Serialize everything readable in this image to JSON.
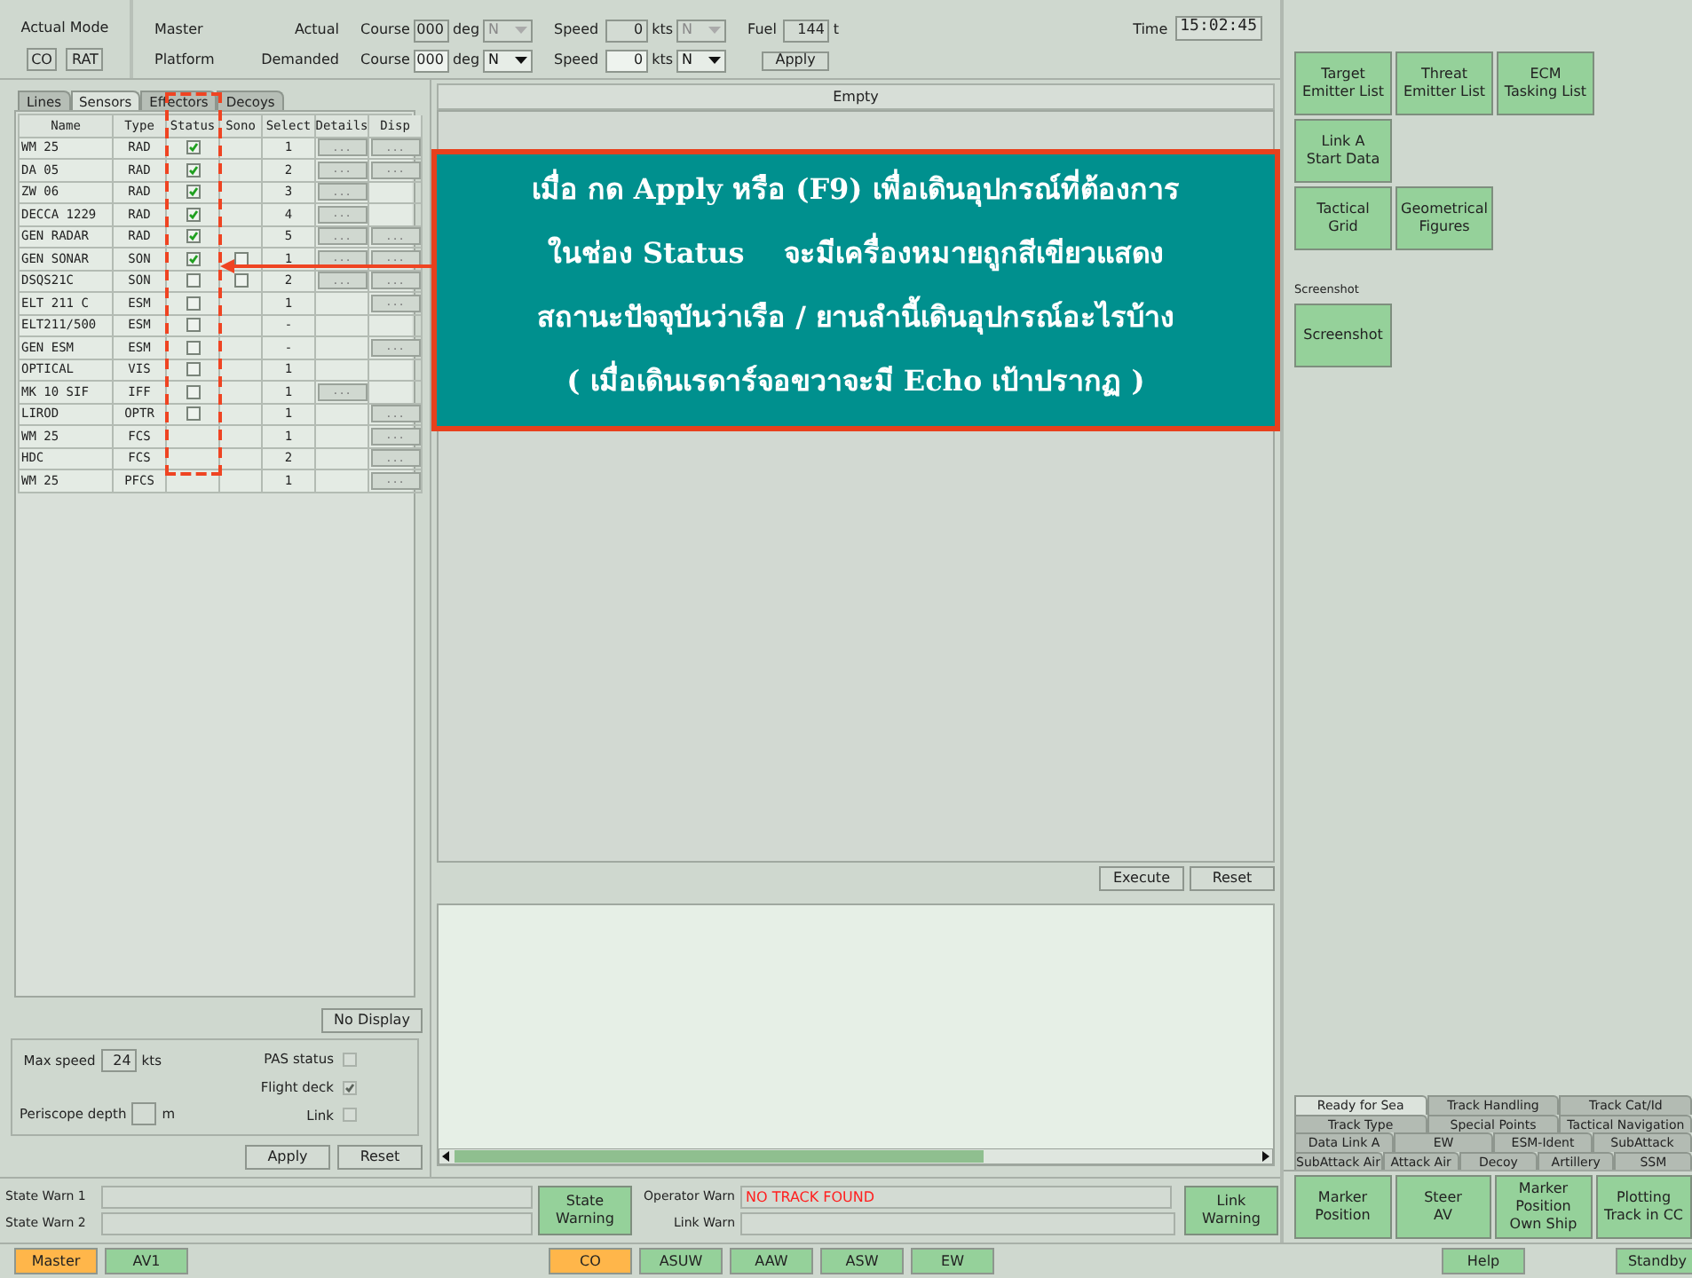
{
  "mode": {
    "label": "Actual Mode",
    "values": [
      "CO",
      "RAT"
    ]
  },
  "nav": {
    "rows": [
      {
        "role": "Master",
        "kind": "Actual",
        "course_label": "Course",
        "course": "000",
        "course_unit": "deg",
        "course_ref": "N",
        "speed_label": "Speed",
        "speed": "0",
        "speed_unit": "kts",
        "speed_ref": "N",
        "disabled": true
      },
      {
        "role": "Platform",
        "kind": "Demanded",
        "course_label": "Course",
        "course": "000",
        "course_unit": "deg",
        "course_ref": "N",
        "speed_label": "Speed",
        "speed": "0",
        "speed_unit": "kts",
        "speed_ref": "N",
        "disabled": false
      }
    ],
    "fuel_label": "Fuel",
    "fuel": "144",
    "fuel_unit": "t",
    "apply": "Apply"
  },
  "time": {
    "label": "Time",
    "value": "15:02:45"
  },
  "left_tabs": [
    {
      "label": "Lines",
      "selected": false
    },
    {
      "label": "Sensors",
      "selected": true
    },
    {
      "label": "Effectors",
      "selected": false
    },
    {
      "label": "Decoys",
      "selected": false
    }
  ],
  "table": {
    "columns": [
      "Name",
      "Type",
      "Status",
      "Sono",
      "Select",
      "Details",
      "Disp"
    ],
    "rows": [
      {
        "name": "WM 25",
        "type": "RAD",
        "status": true,
        "select": "1",
        "details": "...",
        "disp": "..."
      },
      {
        "name": "DA 05",
        "type": "RAD",
        "status": true,
        "select": "2",
        "details": "...",
        "disp": "..."
      },
      {
        "name": "ZW 06",
        "type": "RAD",
        "status": true,
        "select": "3",
        "details": "..."
      },
      {
        "name": "DECCA 1229",
        "type": "RAD",
        "status": true,
        "select": "4",
        "details": "..."
      },
      {
        "name": "GEN RADAR",
        "type": "RAD",
        "status": true,
        "select": "5",
        "details": "...",
        "disp": "..."
      },
      {
        "name": "GEN SONAR",
        "type": "SON",
        "status": true,
        "sono": false,
        "select": "1",
        "details": "...",
        "disp": "..."
      },
      {
        "name": "DSQS21C",
        "type": "SON",
        "status": false,
        "sono": false,
        "select": "2",
        "details": "...",
        "disp": "..."
      },
      {
        "name": "ELT 211 C",
        "type": "ESM",
        "status": false,
        "select": "1",
        "disp": "..."
      },
      {
        "name": "ELT211/500",
        "type": "ESM",
        "status": false,
        "select": "-"
      },
      {
        "name": "GEN ESM",
        "type": "ESM",
        "status": false,
        "select": "-",
        "disp": "..."
      },
      {
        "name": "OPTICAL",
        "type": "VIS",
        "status": false,
        "select": "1"
      },
      {
        "name": "MK 10 SIF",
        "type": "IFF",
        "status": false,
        "select": "1",
        "details": "..."
      },
      {
        "name": "LIROD",
        "type": "OPTR",
        "status": false,
        "select": "1",
        "disp": "..."
      },
      {
        "name": "WM 25",
        "type": "FCS",
        "select": "1",
        "disp": "..."
      },
      {
        "name": "HDC",
        "type": "FCS",
        "select": "2",
        "disp": "..."
      },
      {
        "name": "WM 25",
        "type": "PFCS",
        "select": "1",
        "disp": "..."
      }
    ]
  },
  "no_display": "No Display",
  "settings": {
    "max_speed_label": "Max speed",
    "max_speed": "24",
    "max_speed_unit": "kts",
    "periscope_label": "Periscope depth",
    "periscope_unit": "m",
    "flags": [
      {
        "label": "PAS status",
        "checked": false
      },
      {
        "label": "Flight deck",
        "checked": true
      },
      {
        "label": "Link",
        "checked": false
      }
    ]
  },
  "left_buttons": [
    "Apply",
    "Reset"
  ],
  "center": {
    "title": "Empty",
    "buttons": [
      "Execute",
      "Reset"
    ]
  },
  "warnings": {
    "state_labels": [
      "State Warn 1",
      "State Warn 2"
    ],
    "state_button": "State Warning",
    "operator_label": "Operator Warn",
    "operator_value": "NO TRACK FOUND",
    "link_label": "Link Warn",
    "link_button": "Link Warning"
  },
  "right_buttons": [
    [
      "Target\nEmitter List",
      "Threat\nEmitter List",
      "ECM\nTasking List"
    ],
    [
      "Link A\nStart Data"
    ],
    [
      "Tactical\nGrid",
      "Geometrical\nFigures"
    ]
  ],
  "screenshot": {
    "label": "Screenshot",
    "button": "Screenshot"
  },
  "bottom_tabs": [
    [
      {
        "label": "Ready for Sea",
        "selected": true
      },
      {
        "label": "Track Handling",
        "selected": false
      },
      {
        "label": "Track Cat/Id",
        "selected": false
      }
    ],
    [
      {
        "label": "Track Type",
        "selected": false
      },
      {
        "label": "Special Points",
        "selected": false
      },
      {
        "label": "Tactical Navigation",
        "selected": false
      }
    ],
    [
      {
        "label": "Data Link A",
        "selected": false
      },
      {
        "label": "EW",
        "selected": false
      },
      {
        "label": "ESM-Ident",
        "selected": false
      },
      {
        "label": "SubAttack",
        "selected": false
      }
    ],
    [
      {
        "label": "SubAttack Air",
        "selected": false
      },
      {
        "label": "Attack Air",
        "selected": false
      },
      {
        "label": "Decoy",
        "selected": false
      },
      {
        "label": "Artillery",
        "selected": false
      },
      {
        "label": "SSM",
        "selected": false
      }
    ]
  ],
  "action_buttons": [
    "Marker\nPosition",
    "Steer\nAV",
    "Marker\nPosition\nOwn Ship",
    "Plotting\nTrack in CC"
  ],
  "bottom_bar": [
    [
      {
        "label": "Master",
        "active": true
      },
      {
        "label": "AV1",
        "active": false
      }
    ],
    [
      {
        "label": "CO",
        "active": true
      },
      {
        "label": "ASUW",
        "active": false
      },
      {
        "label": "AAW",
        "active": false
      },
      {
        "label": "ASW",
        "active": false
      },
      {
        "label": "EW",
        "active": false
      }
    ],
    [
      {
        "label": "Help",
        "active": false
      }
    ],
    [
      {
        "label": "Standby",
        "active": false
      }
    ]
  ],
  "annotation": {
    "lines": [
      "เมื่อ กด Apply หรือ (F9) เพื่อเดินอุปกรณ์ที่ต้องการ",
      "ในช่อง Status    จะมีเครื่องหมายถูกสีเขียวแสดง",
      "สถานะปัจจุบันว่าเรือ / ยานลำนี้เดินอุปกรณ์อะไรบ้าง",
      "( เมื่อเดินเรดาร์จอขวาจะมี Echo เป้าปรากฏ )"
    ]
  }
}
